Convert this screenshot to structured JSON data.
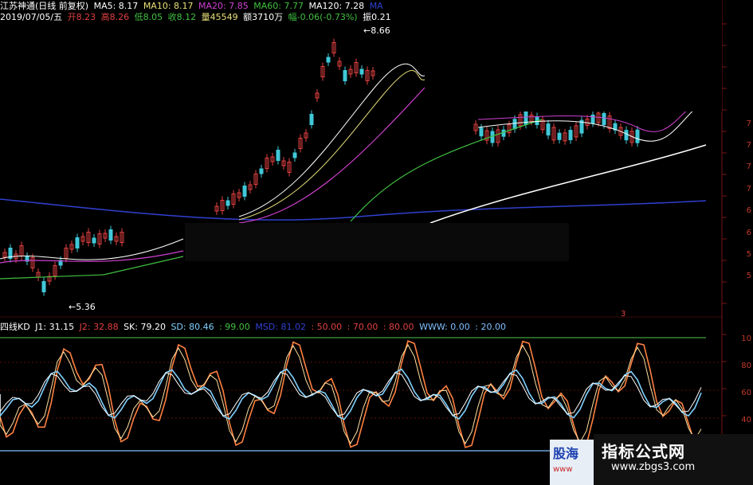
{
  "header": {
    "stock": "江苏神通(日线 前复权)",
    "ma5": "MA5: 8.17",
    "ma10": "MA10: 8.17",
    "ma20": "MA20: 7.85",
    "ma60": "MA60: 7.77",
    "ma120": "MA120: 7.28",
    "ma_extra": "MA",
    "date": "2019/07/05/五",
    "open": "开8.23",
    "high": "高8.26",
    "low": "低8.05",
    "close": "收8.12",
    "volume": "量45549",
    "amount": "额3710万",
    "change": "幅-0.06(-0.73%)",
    "amplitude": "振0.21"
  },
  "price_labels": {
    "high": "8.66",
    "low": "5.36"
  },
  "indicator": {
    "name": "四线KD",
    "j1": "J1: 31.15",
    "j2": "J2: 32.88",
    "sk": "SK: 79.20",
    "sd": "SD: 80.46",
    "c99": ": 99.00",
    "msd": "MSD: 81.02",
    "c50": ": 50.00",
    "c70": ": 70.00",
    "c80": ": 80.00",
    "www": "WWW: 0.00",
    "c20": ": 20.00"
  },
  "axis_ticks": {
    "price": [
      "7",
      "7",
      "7",
      "7",
      "6",
      "6",
      "5",
      "5"
    ],
    "indicator": [
      "10",
      "80",
      "60",
      "40"
    ]
  },
  "marker": "3",
  "watermark": {
    "title": "指标公式网",
    "site": "www.zbgs3.com",
    "badge_a": "股海",
    "badge_b": "www"
  },
  "colors": {
    "up": "#e04040",
    "down": "#40c8d8",
    "ma5": "#ffffff",
    "ma10": "#e8e07a",
    "ma20": "#d040d0",
    "ma60": "#40c040",
    "ma120": "#ffffff",
    "ma250": "#3040d0",
    "kd1": "#ff8040",
    "kd2": "#ffe0a0",
    "kd3": "#80d0ff",
    "green_line": "#40a040",
    "blue_line": "#80c0ff"
  }
}
